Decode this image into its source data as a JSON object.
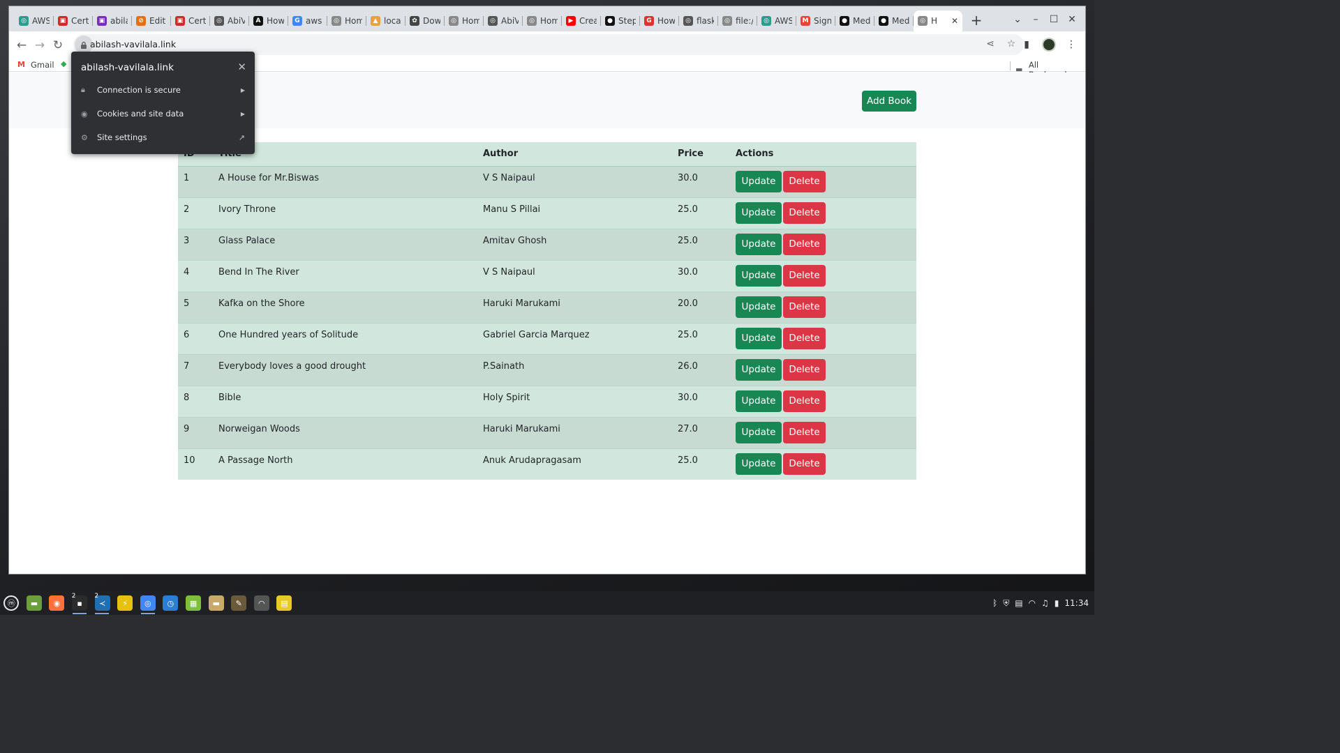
{
  "browser": {
    "tabs": [
      {
        "label": "AWS",
        "fav_color": "#2a9d8f",
        "fav_glyph": "◎"
      },
      {
        "label": "Certi",
        "fav_color": "#d62828",
        "fav_glyph": "▣"
      },
      {
        "label": "abila",
        "fav_color": "#7b2cbf",
        "fav_glyph": "▣"
      },
      {
        "label": "Edit",
        "fav_color": "#e76f11",
        "fav_glyph": "⊘"
      },
      {
        "label": "Certi",
        "fav_color": "#d62828",
        "fav_glyph": "▣"
      },
      {
        "label": "AbiV",
        "fav_color": "#555555",
        "fav_glyph": "◎"
      },
      {
        "label": "How",
        "fav_color": "#111111",
        "fav_glyph": "A"
      },
      {
        "label": "aws",
        "fav_color": "#4285f4",
        "fav_glyph": "G"
      },
      {
        "label": "Hom",
        "fav_color": "#888888",
        "fav_glyph": "◎"
      },
      {
        "label": "local",
        "fav_color": "#e9a23b",
        "fav_glyph": "▲"
      },
      {
        "label": "Dow",
        "fav_color": "#444444",
        "fav_glyph": "✿"
      },
      {
        "label": "Hom",
        "fav_color": "#888888",
        "fav_glyph": "◎"
      },
      {
        "label": "AbiV",
        "fav_color": "#555555",
        "fav_glyph": "◎"
      },
      {
        "label": "Hom",
        "fav_color": "#888888",
        "fav_glyph": "◎"
      },
      {
        "label": "Crea",
        "fav_color": "#ff0000",
        "fav_glyph": "▶"
      },
      {
        "label": "Step",
        "fav_color": "#111111",
        "fav_glyph": "●"
      },
      {
        "label": "How",
        "fav_color": "#e03131",
        "fav_glyph": "G"
      },
      {
        "label": "flask",
        "fav_color": "#555555",
        "fav_glyph": "◎"
      },
      {
        "label": "file:/",
        "fav_color": "#888888",
        "fav_glyph": "◎"
      },
      {
        "label": "AWS",
        "fav_color": "#2a9d8f",
        "fav_glyph": "◎"
      },
      {
        "label": "Sign",
        "fav_color": "#ea4335",
        "fav_glyph": "M"
      },
      {
        "label": "Medi",
        "fav_color": "#111111",
        "fav_glyph": "●"
      },
      {
        "label": "Medi",
        "fav_color": "#111111",
        "fav_glyph": "●"
      }
    ],
    "active_tab": {
      "label": "H",
      "fav_color": "#888888",
      "fav_glyph": "◎"
    },
    "url": "abilash-vavilala.link",
    "bookmarks": [
      {
        "label": "Gmail",
        "icon": "M",
        "color": "#ea4335"
      }
    ],
    "all_bookmarks": "All Bookmarks"
  },
  "site_popup": {
    "title": "abilash-vavilala.link",
    "rows": [
      {
        "label": "Connection is secure",
        "icon": "lock-icon"
      },
      {
        "label": "Cookies and site data",
        "icon": "cookie-icon"
      },
      {
        "label": "Site settings",
        "icon": "gear-icon"
      }
    ]
  },
  "page": {
    "add_book_label": "Add Book",
    "table": {
      "headers": {
        "id": "ID",
        "title": "Title",
        "author": "Author",
        "price": "Price",
        "actions": "Actions"
      },
      "update_label": "Update",
      "delete_label": "Delete",
      "rows": [
        {
          "id": "1",
          "title": "A House for Mr.Biswas",
          "author": "V S Naipaul",
          "price": "30.0"
        },
        {
          "id": "2",
          "title": "Ivory Throne",
          "author": "Manu S Pillai",
          "price": "25.0"
        },
        {
          "id": "3",
          "title": "Glass Palace",
          "author": "Amitav Ghosh",
          "price": "25.0"
        },
        {
          "id": "4",
          "title": "Bend In The River",
          "author": "V S Naipaul",
          "price": "30.0"
        },
        {
          "id": "5",
          "title": "Kafka on the Shore",
          "author": "Haruki Marukami",
          "price": "20.0"
        },
        {
          "id": "6",
          "title": "One Hundred years of Solitude",
          "author": "Gabriel Garcia Marquez",
          "price": "25.0"
        },
        {
          "id": "7",
          "title": "Everybody loves a good drought",
          "author": "P.Sainath",
          "price": "26.0"
        },
        {
          "id": "8",
          "title": "Bible",
          "author": "Holy Spirit",
          "price": "30.0"
        },
        {
          "id": "9",
          "title": "Norweigan Woods",
          "author": "Haruki Marukami",
          "price": "27.0"
        },
        {
          "id": "10",
          "title": "A Passage North",
          "author": "Anuk Arudapragasam",
          "price": "25.0"
        }
      ]
    },
    "colors": {
      "success": "#198754",
      "danger": "#dc3545",
      "table_bg": "#d1e7dd"
    }
  },
  "taskbar": {
    "apps": [
      {
        "name": "mint-menu-icon",
        "color": "#1f2023",
        "glyph": "ⓜ",
        "badge": ""
      },
      {
        "name": "files-icon",
        "color": "#6a9f3a",
        "glyph": "▬",
        "badge": ""
      },
      {
        "name": "firefox-icon",
        "color": "#ff7139",
        "glyph": "◉",
        "badge": ""
      },
      {
        "name": "terminal-icon",
        "color": "#2b2b2b",
        "glyph": "▪",
        "badge": "2"
      },
      {
        "name": "vscode-icon",
        "color": "#1f6fb2",
        "glyph": "≺",
        "badge": "2"
      },
      {
        "name": "bolt-icon",
        "color": "#e4c20f",
        "glyph": "⚡",
        "badge": ""
      },
      {
        "name": "chrome-icon",
        "color": "#4285f4",
        "glyph": "◎",
        "badge": ""
      },
      {
        "name": "clock-icon",
        "color": "#2a7fd4",
        "glyph": "◷",
        "badge": ""
      },
      {
        "name": "calc-icon",
        "color": "#7bbf3a",
        "glyph": "▦",
        "badge": ""
      },
      {
        "name": "folder-icon",
        "color": "#c9a96a",
        "glyph": "▬",
        "badge": ""
      },
      {
        "name": "gimp-icon",
        "color": "#6b5a3a",
        "glyph": "✎",
        "badge": ""
      },
      {
        "name": "network-icon",
        "color": "#555555",
        "glyph": "◠",
        "badge": ""
      },
      {
        "name": "notes-icon",
        "color": "#e7c928",
        "glyph": "▤",
        "badge": ""
      }
    ],
    "time": "11:34"
  }
}
